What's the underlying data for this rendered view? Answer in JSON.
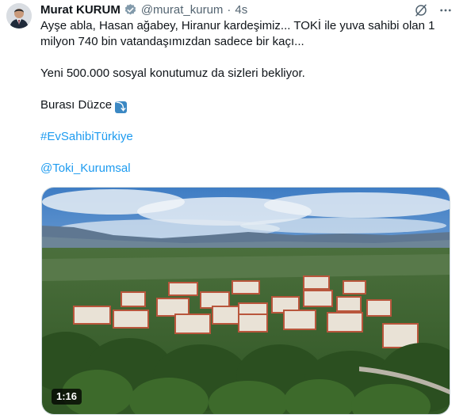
{
  "tweet": {
    "author_name": "Murat KURUM",
    "handle": "@murat_kurum",
    "separator": "·",
    "time": "4s",
    "lines": [
      "Ayşe abla, Hasan ağabey, Hiranur kardeşimiz... TOKİ ile yuva sahibi olan 1",
      "milyon 740 bin vatandaşımızdan sadece bir kaçı..."
    ],
    "paragraph2": "Yeni 500.000 sosyal konutumuz da sizleri bekliyor.",
    "paragraph3": "Burası Düzce",
    "hashtag": "#EvSahibiTürkiye",
    "mention": "@Toki_Kurumsal",
    "media": {
      "duration": "1:16"
    }
  },
  "icons": {
    "verified": "verified-badge-icon",
    "grok": "grok-icon",
    "more": "more-icon",
    "arrow": "arrow-down-right-emoji"
  },
  "colors": {
    "link": "#1d9bf0",
    "secondary": "#536471",
    "text": "#0f1419"
  }
}
